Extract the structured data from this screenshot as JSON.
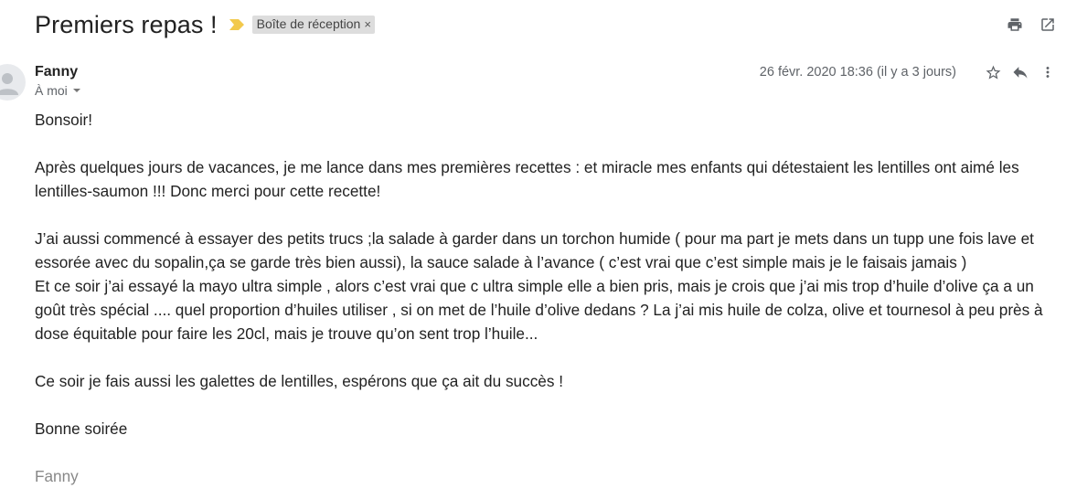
{
  "email": {
    "subject": "Premiers repas !",
    "label": "Boîte de réception",
    "label_remove": "×",
    "sender": "Fanny",
    "recipient": "À moi",
    "date": "26 févr. 2020 18:36 (il y a 3 jours)",
    "body": {
      "greeting": "Bonsoir!",
      "para1": "Après quelques jours de vacances, je me lance dans mes premières recettes : et miracle mes enfants qui détestaient les lentilles ont aimé les lentilles-saumon !!! Donc merci pour cette recette!",
      "para2_line1": "J’ai aussi commencé à essayer des petits trucs ;la salade à garder dans un torchon humide ( pour ma part je mets dans un tupp une fois lave et essorée avec du sopalin,ça se garde très bien aussi), la sauce salade à l’avance ( c’est vrai que c’est simple mais je le faisais jamais )",
      "para2_line2": "Et ce soir j’ai essayé la mayo ultra simple , alors c’est vrai que c ultra simple elle a bien pris, mais je crois que j’ai mis trop d’huile d’olive ça a un goût très spécial .... quel proportion d’huiles utiliser , si on met de l’huile d’olive dedans ? La j’ai mis huile de colza, olive et tournesol à peu près à dose équitable pour faire les 20cl, mais je trouve qu’on sent trop l’huile...",
      "para3": "Ce soir je fais aussi les galettes de lentilles, espérons que ça ait du succès !",
      "closing": "Bonne soirée",
      "signature": "Fanny"
    }
  },
  "icons": {
    "importance": "importance-marker-icon",
    "print": "print-icon",
    "open_new_window": "open-in-new-window-icon",
    "avatar": "person-icon",
    "star": "star-icon",
    "reply": "reply-icon",
    "more": "more-vert-icon"
  },
  "colors": {
    "importance_marker": "#f2c94c",
    "label_chip_bg": "#dddddd",
    "signature_text": "#888888"
  }
}
